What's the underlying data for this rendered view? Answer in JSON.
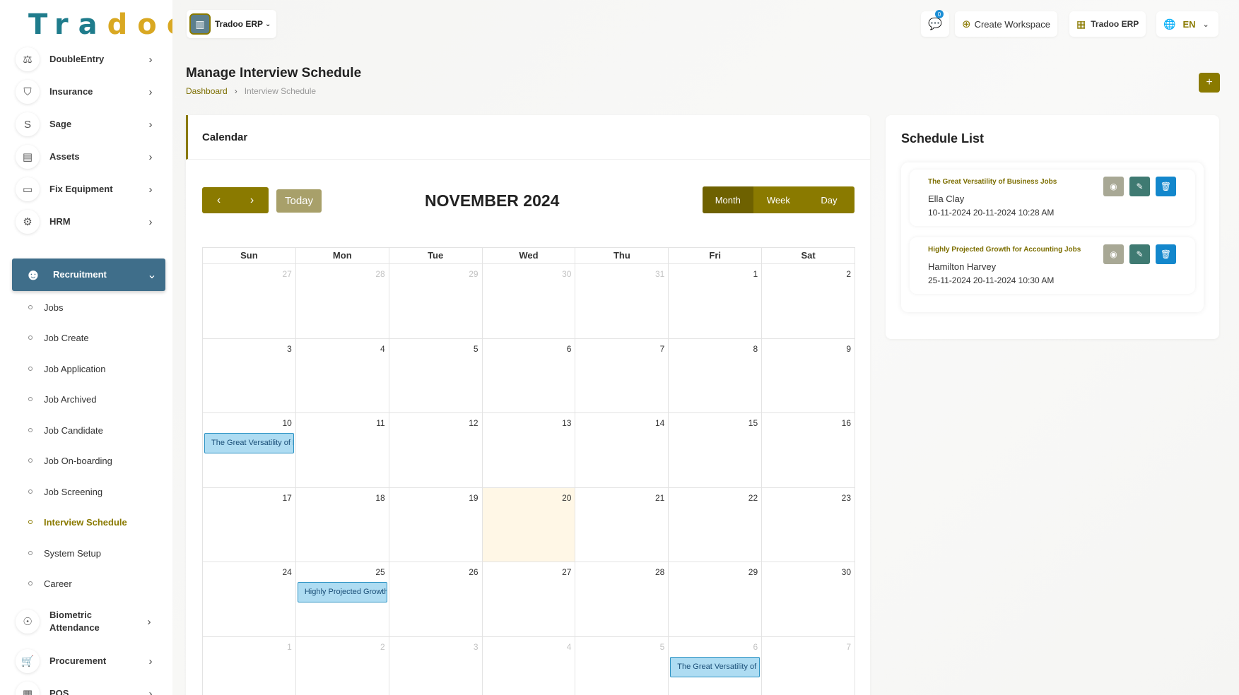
{
  "brand": {
    "logo_part1": "Tra",
    "logo_part2": "doo"
  },
  "sidebar": {
    "menu": [
      {
        "label": "DoubleEntry",
        "icon": "scale-icon",
        "glyph": "⚖"
      },
      {
        "label": "Insurance",
        "icon": "shield-icon",
        "glyph": "⛉"
      },
      {
        "label": "Sage",
        "icon": "letter-s-icon",
        "glyph": "S"
      },
      {
        "label": "Assets",
        "icon": "calculator-icon",
        "glyph": "▤"
      },
      {
        "label": "Fix Equipment",
        "icon": "archive-icon",
        "glyph": "▭"
      },
      {
        "label": "HRM",
        "icon": "network-icon",
        "glyph": "⚙"
      }
    ],
    "active": {
      "label": "Recruitment",
      "icon": "people-search-icon",
      "glyph": "☻"
    },
    "submenu": [
      "Jobs",
      "Job Create",
      "Job Application",
      "Job Archived",
      "Job Candidate",
      "Job On-boarding",
      "Job Screening",
      "Interview Schedule",
      "System Setup",
      "Career"
    ],
    "active_sub": "Interview Schedule",
    "menu_after": [
      {
        "label": "Biometric Attendance",
        "icon": "fingerprint-icon",
        "glyph": "☉"
      },
      {
        "label": "Procurement",
        "icon": "cart-icon",
        "glyph": "🛒"
      },
      {
        "label": "POS",
        "icon": "pos-icon",
        "glyph": "▦"
      }
    ]
  },
  "topbar": {
    "workspace": "Tradoo ERP",
    "notification_count": "0",
    "create_workspace": "Create Workspace",
    "app_switch": "Tradoo ERP",
    "language": "EN"
  },
  "page": {
    "title": "Manage Interview Schedule",
    "breadcrumb_home": "Dashboard",
    "breadcrumb_current": "Interview Schedule",
    "add_label": "+"
  },
  "calendar": {
    "card_title": "Calendar",
    "today_label": "Today",
    "month_title": "NOVEMBER 2024",
    "views": [
      "Month",
      "Week",
      "Day"
    ],
    "active_view": "Month",
    "weekdays": [
      "Sun",
      "Mon",
      "Tue",
      "Wed",
      "Thu",
      "Fri",
      "Sat"
    ],
    "weeks": [
      [
        {
          "n": "27",
          "o": true
        },
        {
          "n": "28",
          "o": true
        },
        {
          "n": "29",
          "o": true
        },
        {
          "n": "30",
          "o": true
        },
        {
          "n": "31",
          "o": true
        },
        {
          "n": "1"
        },
        {
          "n": "2"
        }
      ],
      [
        {
          "n": "3"
        },
        {
          "n": "4"
        },
        {
          "n": "5"
        },
        {
          "n": "6"
        },
        {
          "n": "7"
        },
        {
          "n": "8"
        },
        {
          "n": "9"
        }
      ],
      [
        {
          "n": "10",
          "event": "The Great Versatility of Business Jobs"
        },
        {
          "n": "11"
        },
        {
          "n": "12"
        },
        {
          "n": "13"
        },
        {
          "n": "14"
        },
        {
          "n": "15"
        },
        {
          "n": "16"
        }
      ],
      [
        {
          "n": "17"
        },
        {
          "n": "18"
        },
        {
          "n": "19"
        },
        {
          "n": "20",
          "today": true
        },
        {
          "n": "21"
        },
        {
          "n": "22"
        },
        {
          "n": "23"
        }
      ],
      [
        {
          "n": "24"
        },
        {
          "n": "25",
          "event": "Highly Projected Growth for Accounting Jobs"
        },
        {
          "n": "26"
        },
        {
          "n": "27"
        },
        {
          "n": "28"
        },
        {
          "n": "29"
        },
        {
          "n": "30"
        }
      ],
      [
        {
          "n": "1",
          "o": true
        },
        {
          "n": "2",
          "o": true
        },
        {
          "n": "3",
          "o": true
        },
        {
          "n": "4",
          "o": true
        },
        {
          "n": "5",
          "o": true
        },
        {
          "n": "6",
          "o": true,
          "event": "The Great Versatility of Business Jobs"
        },
        {
          "n": "7",
          "o": true
        }
      ]
    ]
  },
  "schedule": {
    "title": "Schedule List",
    "items": [
      {
        "job": "The Great Versatility of Business Jobs",
        "name": "Ella Clay",
        "dates": "10-11-2024 20-11-2024 10:28 AM"
      },
      {
        "job": "Highly Projected Growth for Accounting Jobs",
        "name": "Hamilton Harvey",
        "dates": "25-11-2024 20-11-2024 10:30 AM"
      }
    ]
  },
  "colors": {
    "accent": "#8a7a00",
    "sidebar_active": "#3f6e8a",
    "event_bg": "#aedcf2",
    "today_bg": "#fff7e6"
  }
}
